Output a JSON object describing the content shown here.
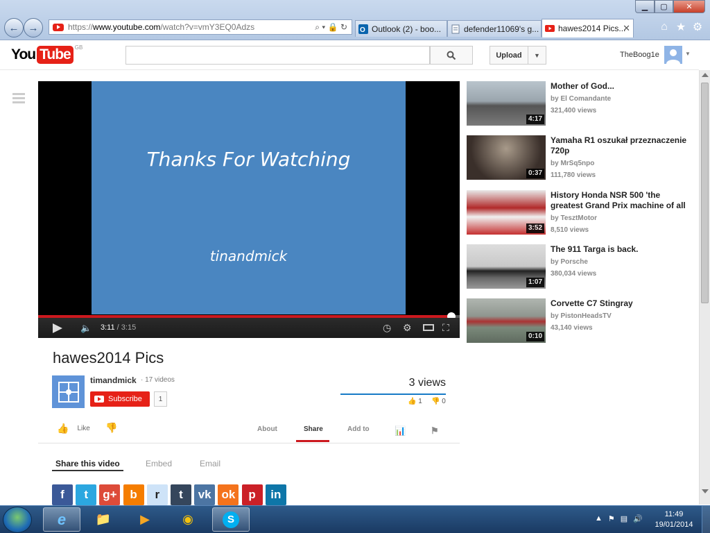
{
  "browser": {
    "address_prefix": "https://",
    "address_host": "www.youtube.com",
    "address_path": "/watch?v=vmY3EQ0Adzs",
    "tabs": [
      {
        "label": "Outlook (2) - boo...",
        "icon": "outlook-icon",
        "active": false
      },
      {
        "label": "defender11069's g...",
        "icon": "page-icon",
        "active": false
      },
      {
        "label": "hawes2014 Pics...",
        "icon": "youtube-icon",
        "active": true
      }
    ],
    "window_buttons": [
      "minimize",
      "maximize",
      "close"
    ]
  },
  "yt_header": {
    "logo_you": "You",
    "logo_tube": "Tube",
    "region": "GB",
    "search_value": "",
    "upload_label": "Upload",
    "username": "TheBoog1e"
  },
  "player": {
    "screen_line1": "Thanks For Watching",
    "screen_line2": "tinandmick",
    "time_current": "3:11",
    "time_separator": "/",
    "time_total": "3:15",
    "progress_fraction": 0.98,
    "colors": {
      "progress": "#cc181e",
      "screen": "#4a86c1"
    }
  },
  "video": {
    "title": "hawes2014 Pics",
    "channel": "timandmick",
    "channel_videos": "· 17 videos",
    "subscribe_label": "Subscribe",
    "subscriber_count": "1",
    "views": "3 views",
    "likes": "1",
    "dislikes": "0",
    "like_label": "Like",
    "action_tabs": {
      "about": "About",
      "share": "Share",
      "addto": "Add to"
    }
  },
  "share": {
    "tabs": {
      "share_video": "Share this video",
      "embed": "Embed",
      "email": "Email"
    },
    "networks": [
      {
        "glyph": "f",
        "color": "#3b5998",
        "name": "facebook-icon"
      },
      {
        "glyph": "t",
        "color": "#2ca7e0",
        "name": "twitter-icon"
      },
      {
        "glyph": "g+",
        "color": "#dd4b39",
        "name": "googleplus-icon"
      },
      {
        "glyph": "b",
        "color": "#f57d00",
        "name": "blogger-icon"
      },
      {
        "glyph": "r",
        "color": "#cee3f8",
        "name": "reddit-icon"
      },
      {
        "glyph": "t",
        "color": "#35465c",
        "name": "tumblr-icon"
      },
      {
        "glyph": "vk",
        "color": "#4c75a3",
        "name": "vk-icon"
      },
      {
        "glyph": "ok",
        "color": "#f4731c",
        "name": "odnoklassniki-icon"
      },
      {
        "glyph": "p",
        "color": "#cb2027",
        "name": "pinterest-icon"
      },
      {
        "glyph": "in",
        "color": "#0e76a8",
        "name": "linkedin-icon"
      }
    ]
  },
  "related": [
    {
      "title": "Mother of God...",
      "by": "by",
      "channel": "El Comandante",
      "views": "321,400 views",
      "duration": "4:17",
      "thumb": "linear-gradient(#b9c4cc 0%,#9aa5ad 45%,#555 55%,#7a7a7a 100%)"
    },
    {
      "title": "Yamaha R1 oszukał przeznaczenie 720p",
      "by": "by",
      "channel": "MrSq5npo",
      "views": "111,780 views",
      "duration": "0:37",
      "thumb": "radial-gradient(circle at 50% 30%,#a89a8a,#3a2f2a 70%)"
    },
    {
      "title": "History Honda NSR 500 'the greatest Grand Prix machine of all",
      "by": "by",
      "channel": "TesztMotor",
      "views": "8,510 views",
      "duration": "3:52",
      "thumb": "linear-gradient(#e8e8e8 0%,#b12a2a 40%,#f0f0f0 60%,#c53030 100%)"
    },
    {
      "title": "The 911 Targa is back.",
      "by": "by",
      "channel": "Porsche",
      "views": "380,034 views",
      "duration": "1:07",
      "thumb": "linear-gradient(#ddd 0%,#c8c8c8 50%,#222 60%,#666 75%,#999 100%)"
    },
    {
      "title": "Corvette C7 Stingray",
      "by": "by",
      "channel": "PistonHeadsTV",
      "views": "43,140 views",
      "duration": "0:10",
      "thumb": "linear-gradient(#b0b6b0 0%,#8f968f 40%,#a33 52%,#7b8a7b 65%,#5f6b5f 100%)"
    }
  ],
  "taskbar": {
    "time": "11:49",
    "date": "19/01/2014"
  }
}
